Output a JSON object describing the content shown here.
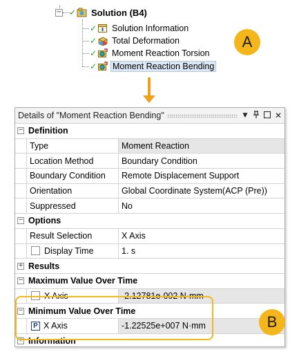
{
  "tree": {
    "root": {
      "label": "Solution (B4)"
    },
    "children": [
      {
        "label": "Solution Information",
        "icon": "solution-info-icon"
      },
      {
        "label": "Total Deformation",
        "icon": "result-icon"
      },
      {
        "label": "Moment Reaction Torsion",
        "icon": "probe-icon"
      },
      {
        "label": "Moment Reaction Bending",
        "icon": "probe-icon",
        "selected": true
      }
    ]
  },
  "callouts": {
    "a": "A",
    "b": "B"
  },
  "colors": {
    "accent": "#f4b61a",
    "check": "#2e9e2e",
    "selection": "#dde8f5"
  },
  "details": {
    "title": "Details of \"Moment Reaction Bending\"",
    "sections": {
      "definition": {
        "title": "Definition",
        "rows": [
          {
            "label": "Type",
            "value": "Moment Reaction"
          },
          {
            "label": "Location Method",
            "value": "Boundary Condition"
          },
          {
            "label": "Boundary Condition",
            "value": "Remote Displacement Support"
          },
          {
            "label": "Orientation",
            "value": "Global Coordinate System(ACP (Pre))"
          },
          {
            "label": "Suppressed",
            "value": "No"
          }
        ]
      },
      "options": {
        "title": "Options",
        "rows": [
          {
            "label": "Result Selection",
            "value": "X Axis"
          },
          {
            "label": "Display Time",
            "value": "1. s"
          }
        ]
      },
      "results": {
        "title": "Results"
      },
      "max": {
        "title": "Maximum Value Over Time",
        "rows": [
          {
            "label": "X Axis",
            "value": "-2.12781e-002 N·mm"
          }
        ]
      },
      "min": {
        "title": "Minimum Value Over Time",
        "rows": [
          {
            "label": "X Axis",
            "value": "-1.22525e+007 N·mm",
            "badge": "P"
          }
        ]
      },
      "information": {
        "title": "Information"
      }
    }
  }
}
